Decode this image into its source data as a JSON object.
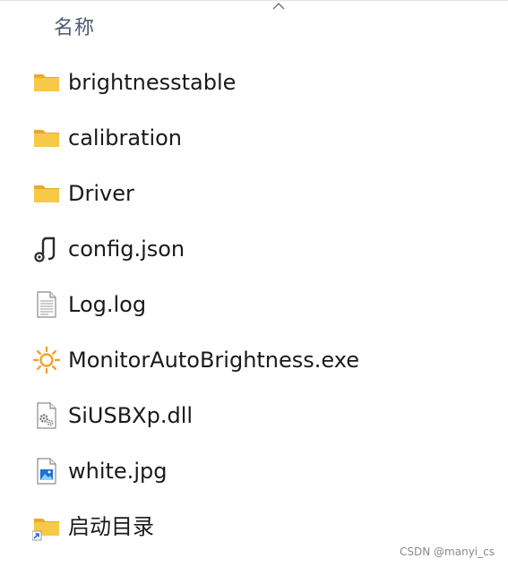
{
  "header": {
    "name_column": "名称"
  },
  "files": [
    {
      "name": "brightnesstable",
      "icon": "folder-icon"
    },
    {
      "name": "calibration",
      "icon": "folder-icon"
    },
    {
      "name": "Driver",
      "icon": "folder-icon"
    },
    {
      "name": "config.json",
      "icon": "json-file-icon"
    },
    {
      "name": "Log.log",
      "icon": "text-file-icon"
    },
    {
      "name": "MonitorAutoBrightness.exe",
      "icon": "sun-icon"
    },
    {
      "name": "SiUSBXp.dll",
      "icon": "dll-file-icon"
    },
    {
      "name": "white.jpg",
      "icon": "image-file-icon"
    },
    {
      "name": "启动目录",
      "icon": "folder-shortcut-icon"
    }
  ],
  "watermark": "CSDN @manyi_cs",
  "colors": {
    "folder": "#f7c948",
    "folder_dark": "#e8a92e",
    "header_text": "#4a5d75",
    "sun": "#f2a22a",
    "shortcut_arrow": "#1f6fd6"
  }
}
